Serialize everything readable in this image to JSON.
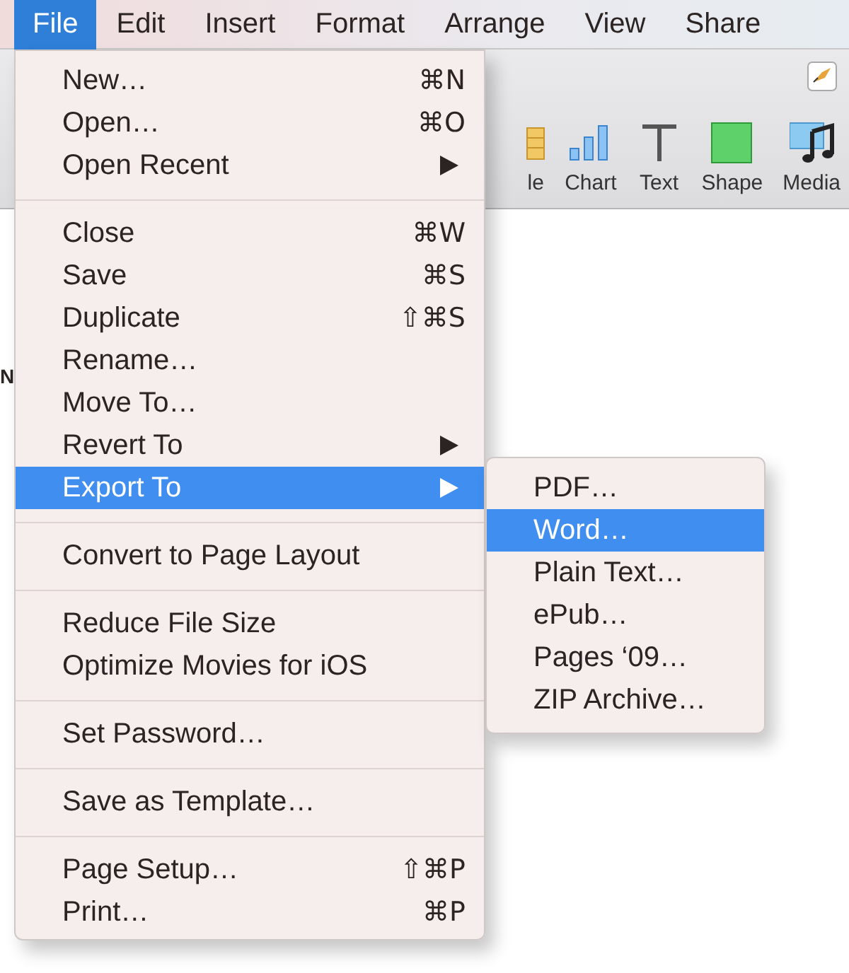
{
  "menubar": {
    "items": [
      {
        "label": "File",
        "selected": true
      },
      {
        "label": "Edit",
        "selected": false
      },
      {
        "label": "Insert",
        "selected": false
      },
      {
        "label": "Format",
        "selected": false
      },
      {
        "label": "Arrange",
        "selected": false
      },
      {
        "label": "View",
        "selected": false
      },
      {
        "label": "Share",
        "selected": false
      }
    ]
  },
  "toolbar": {
    "items": [
      {
        "kind": "table",
        "label": "le"
      },
      {
        "kind": "chart",
        "label": "Chart"
      },
      {
        "kind": "text",
        "label": "Text"
      },
      {
        "kind": "shape",
        "label": "Shape"
      },
      {
        "kind": "media",
        "label": "Media"
      }
    ]
  },
  "document": {
    "text": "N"
  },
  "file_menu": {
    "groups": [
      [
        {
          "label": "New…",
          "shortcut": "⌘N",
          "has_submenu": false,
          "selected": false
        },
        {
          "label": "Open…",
          "shortcut": "⌘O",
          "has_submenu": false,
          "selected": false
        },
        {
          "label": "Open Recent",
          "has_submenu": true,
          "selected": false
        }
      ],
      [
        {
          "label": "Close",
          "shortcut": "⌘W",
          "has_submenu": false,
          "selected": false
        },
        {
          "label": "Save",
          "shortcut": "⌘S",
          "has_submenu": false,
          "selected": false
        },
        {
          "label": "Duplicate",
          "shortcut": "⇧⌘S",
          "has_submenu": false,
          "selected": false
        },
        {
          "label": "Rename…",
          "has_submenu": false,
          "selected": false
        },
        {
          "label": "Move To…",
          "has_submenu": false,
          "selected": false
        },
        {
          "label": "Revert To",
          "has_submenu": true,
          "selected": false
        },
        {
          "label": "Export To",
          "has_submenu": true,
          "selected": true
        }
      ],
      [
        {
          "label": "Convert to Page Layout",
          "has_submenu": false,
          "selected": false
        }
      ],
      [
        {
          "label": "Reduce File Size",
          "has_submenu": false,
          "selected": false
        },
        {
          "label": "Optimize Movies for iOS",
          "has_submenu": false,
          "selected": false
        }
      ],
      [
        {
          "label": "Set Password…",
          "has_submenu": false,
          "selected": false
        }
      ],
      [
        {
          "label": "Save as Template…",
          "has_submenu": false,
          "selected": false
        }
      ],
      [
        {
          "label": "Page Setup…",
          "shortcut": "⇧⌘P",
          "has_submenu": false,
          "selected": false
        },
        {
          "label": "Print…",
          "shortcut": "⌘P",
          "has_submenu": false,
          "selected": false
        }
      ]
    ]
  },
  "export_submenu": {
    "items": [
      {
        "label": "PDF…",
        "selected": false
      },
      {
        "label": "Word…",
        "selected": true
      },
      {
        "label": "Plain Text…",
        "selected": false
      },
      {
        "label": "ePub…",
        "selected": false
      },
      {
        "label": "Pages ‘09…",
        "selected": false
      },
      {
        "label": "ZIP Archive…",
        "selected": false
      }
    ]
  }
}
